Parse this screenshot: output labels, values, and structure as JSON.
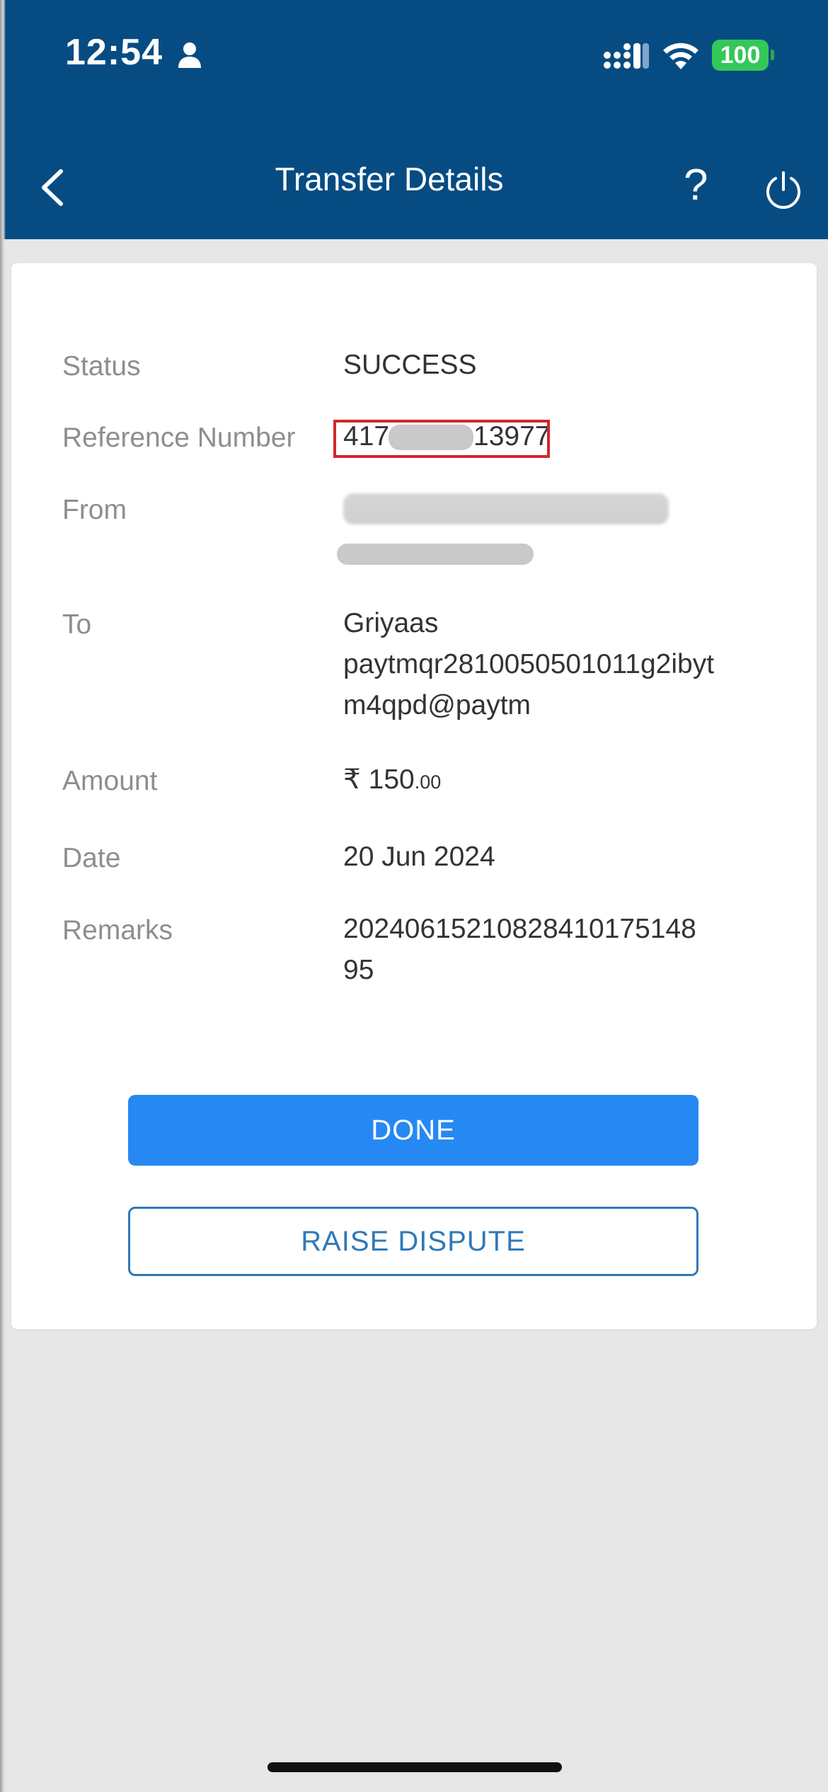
{
  "status_bar": {
    "time": "12:54",
    "battery": "100"
  },
  "header": {
    "title": "Transfer Details",
    "help": "?"
  },
  "details": {
    "status": {
      "label": "Status",
      "value": "SUCCESS"
    },
    "reference": {
      "label": "Reference Number",
      "value_start": "417",
      "value_end": "13977"
    },
    "from": {
      "label": "From"
    },
    "to": {
      "label": "To",
      "name": "Griyaas",
      "vpa_line1": "paytmqr2810050501011g2ibyt",
      "vpa_line2": "m4qpd@paytm"
    },
    "amount": {
      "label": "Amount",
      "currency": "₹",
      "whole": "150",
      "decimal": ".00"
    },
    "date": {
      "label": "Date",
      "value": "20 Jun 2024"
    },
    "remarks": {
      "label": "Remarks",
      "line1": "20240615210828410175148",
      "line2": "95"
    }
  },
  "actions": {
    "done": "DONE",
    "raise_dispute": "RAISE DISPUTE"
  },
  "colors": {
    "header_bg": "#064c83",
    "primary_button": "#2688f2",
    "outline_button": "#2f79b8",
    "highlight_box": "#d1272c",
    "battery": "#34c759"
  }
}
